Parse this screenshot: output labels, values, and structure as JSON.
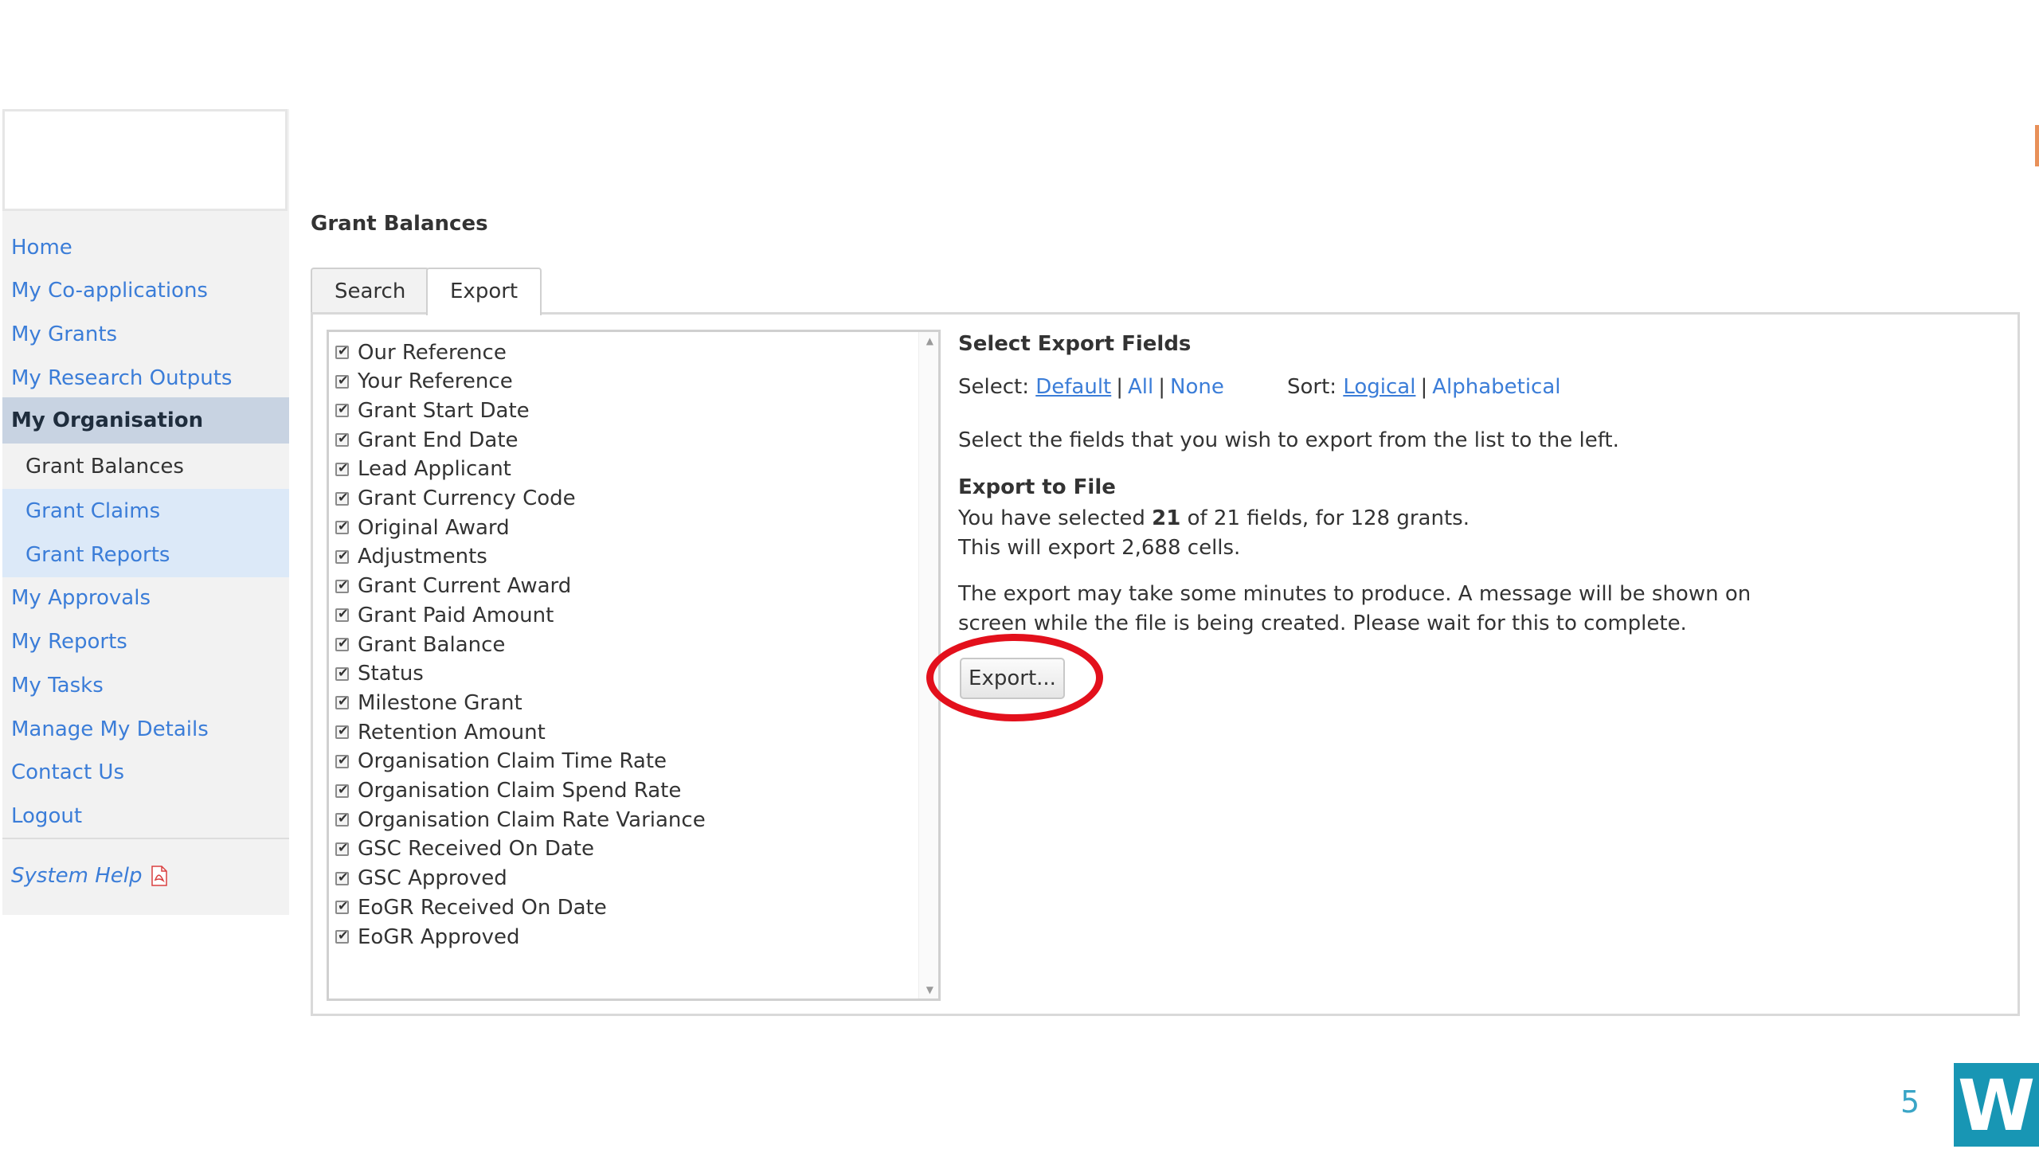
{
  "sidebar": {
    "items": [
      {
        "label": "Home"
      },
      {
        "label": "My Co-applications"
      },
      {
        "label": "My Grants"
      },
      {
        "label": "My Research Outputs"
      },
      {
        "label": "My Organisation"
      },
      {
        "label": "Grant Balances"
      },
      {
        "label": "Grant Claims"
      },
      {
        "label": "Grant Reports"
      },
      {
        "label": "My Approvals"
      },
      {
        "label": "My Reports"
      },
      {
        "label": "My Tasks"
      },
      {
        "label": "Manage My Details"
      },
      {
        "label": "Contact Us"
      },
      {
        "label": "Logout"
      }
    ],
    "help_label": "System Help",
    "help_icon": "pdf-icon"
  },
  "main": {
    "title": "Grant Balances",
    "tabs": [
      {
        "label": "Search"
      },
      {
        "label": "Export"
      }
    ],
    "selected_tab": "Export",
    "fields": [
      {
        "label": "Our Reference",
        "checked": true
      },
      {
        "label": "Your Reference",
        "checked": true
      },
      {
        "label": "Grant Start Date",
        "checked": true
      },
      {
        "label": "Grant End Date",
        "checked": true
      },
      {
        "label": "Lead Applicant",
        "checked": true
      },
      {
        "label": "Grant Currency Code",
        "checked": true
      },
      {
        "label": "Original Award",
        "checked": true
      },
      {
        "label": "Adjustments",
        "checked": true
      },
      {
        "label": "Grant Current Award",
        "checked": true
      },
      {
        "label": "Grant Paid Amount",
        "checked": true
      },
      {
        "label": "Grant Balance",
        "checked": true
      },
      {
        "label": "Status",
        "checked": true
      },
      {
        "label": "Milestone Grant",
        "checked": true
      },
      {
        "label": "Retention Amount",
        "checked": true
      },
      {
        "label": "Organisation Claim Time Rate",
        "checked": true
      },
      {
        "label": "Organisation Claim Spend Rate",
        "checked": true
      },
      {
        "label": "Organisation Claim Rate Variance",
        "checked": true
      },
      {
        "label": "GSC Received On Date",
        "checked": true
      },
      {
        "label": "GSC Approved",
        "checked": true
      },
      {
        "label": "EoGR Received On Date",
        "checked": true
      },
      {
        "label": "EoGR Approved",
        "checked": true
      }
    ],
    "export_fields": {
      "heading": "Select Export Fields",
      "select_label": "Select:",
      "select_default": "Default",
      "select_all": "All",
      "select_none": "None",
      "sort_label": "Sort:",
      "sort_logical": "Logical",
      "sort_alpha": "Alphabetical",
      "instruction": "Select the fields that you wish to export from the list to the left."
    },
    "export_file": {
      "heading": "Export to File",
      "summary_prefix": "You have selected",
      "selected_count": "21",
      "summary_suffix": "of 21 fields, for 128 grants.",
      "cells_line": "This will export 2,688 cells.",
      "wait_line1": "The export may take some minutes to produce. A message will be shown on",
      "wait_line2": "screen while the file is being created. Please wait for this to complete.",
      "button_label": "Export..."
    }
  },
  "slide": {
    "page_number": "5",
    "brand_letter": "W"
  },
  "colors": {
    "link": "#3b7dd8",
    "highlight": "#e3101c",
    "brand": "#1896b4"
  }
}
